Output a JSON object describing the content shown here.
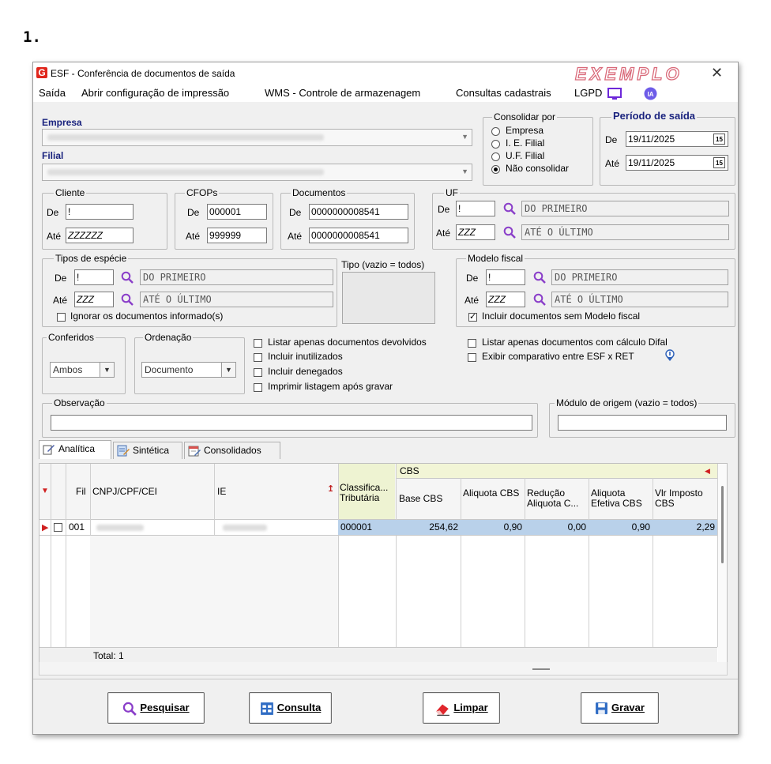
{
  "step_label": "1.",
  "window": {
    "title": "ESF - Conferência de documentos de saída",
    "watermark": "EXEMPLO",
    "close": "✕"
  },
  "menu": [
    "Saída",
    "Abrir configuração de impressão",
    "WMS - Controle de armazenagem",
    "Consultas cadastrais",
    "LGPD"
  ],
  "empresa": {
    "label": "Empresa",
    "value_redacted": true
  },
  "filial": {
    "label": "Filial",
    "value_redacted": true
  },
  "consolidar": {
    "legend": "Consolidar por",
    "options": [
      "Empresa",
      "I. E. Filial",
      "U.F. Filial",
      "Não consolidar"
    ],
    "selected": "Não consolidar"
  },
  "periodo": {
    "legend": "Período de saída",
    "de_label": "De",
    "de": "19/11/2025",
    "ate_label": "Até",
    "ate": "19/11/2025",
    "cal": "15"
  },
  "cliente": {
    "legend": "Cliente",
    "de_label": "De",
    "de": "!",
    "ate_label": "Até",
    "ate": "ZZZZZZ"
  },
  "cfops": {
    "legend": "CFOPs",
    "de_label": "De",
    "de": "000001",
    "ate_label": "Até",
    "ate": "999999"
  },
  "documentos": {
    "legend": "Documentos",
    "de_label": "De",
    "de": "0000000008541",
    "ate_label": "Até",
    "ate": "0000000008541"
  },
  "uf": {
    "legend": "UF",
    "de_label": "De",
    "de": "!",
    "de_desc": "DO PRIMEIRO",
    "ate_label": "Até",
    "ate": "ZZZ",
    "ate_desc": "ATÉ O ÚLTIMO"
  },
  "especie": {
    "legend": "Tipos de espécie",
    "de_label": "De",
    "de": "!",
    "de_desc": "DO PRIMEIRO",
    "ate_label": "Até",
    "ate": "ZZZ",
    "ate_desc": "ATÉ O ÚLTIMO",
    "ignorar": "Ignorar os documentos informado(s)"
  },
  "tipo": {
    "legend": "Tipo (vazio = todos)"
  },
  "modelo": {
    "legend": "Modelo fiscal",
    "de_label": "De",
    "de": "!",
    "de_desc": "DO PRIMEIRO",
    "ate_label": "Até",
    "ate": "ZZZ",
    "ate_desc": "ATÉ O ÚLTIMO",
    "incluir": "Incluir documentos sem Modelo fiscal",
    "incluir_checked": true
  },
  "conferidos": {
    "legend": "Conferidos",
    "value": "Ambos"
  },
  "ordenacao": {
    "legend": "Ordenação",
    "value": "Documento"
  },
  "options": {
    "listar_devolvidos": "Listar apenas documentos devolvidos",
    "incluir_inutilizados": "Incluir inutilizados",
    "incluir_denegados": "Incluir denegados",
    "imprimir_listagem": "Imprimir listagem após gravar",
    "listar_difal": "Listar apenas documentos com cálculo Difal",
    "exibir_comparativo": "Exibir comparativo entre ESF x  RET"
  },
  "observacao": {
    "legend": "Observação",
    "value": ""
  },
  "modulo": {
    "legend": "Módulo de origem (vazio = todos)",
    "value": ""
  },
  "tabs": [
    "Analítica",
    "Sintética",
    "Consolidados"
  ],
  "grid": {
    "group_header": "CBS",
    "columns": [
      "Fil",
      "CNPJ/CPF/CEI",
      "IE",
      "Classifica... Tributária",
      "Base CBS",
      "Aliquota CBS",
      "Redução Aliquota C...",
      "Aliquota Efetiva CBS",
      "Vlr Imposto CBS"
    ],
    "rows": [
      {
        "fil": "001",
        "classificacao": "000001",
        "base_cbs": "254,62",
        "aliquota_cbs": "0,90",
        "reducao": "0,00",
        "efetiva": "0,90",
        "vlr_imposto": "2,29"
      }
    ],
    "total": "Total: 1"
  },
  "buttons": {
    "pesquisar": "Pesquisar",
    "consulta": "Consulta",
    "limpar": "Limpar",
    "gravar": "Gravar"
  },
  "colors": {
    "accent_blue": "#1a237e",
    "selected_row": "#b9d1ea",
    "cbs_header": "#f2f5d6",
    "logo_red": "#e0261c"
  }
}
